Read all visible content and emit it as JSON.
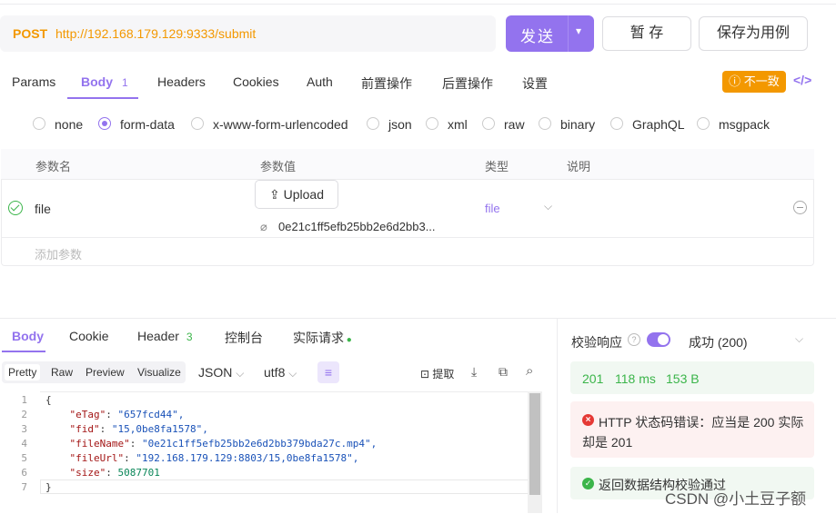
{
  "request": {
    "method": "POST",
    "url": "http://192.168.179.129:9333/submit",
    "send_label": "发送",
    "save_label": "暂 存",
    "save_case_label": "保存为用例"
  },
  "tabs": [
    {
      "label": "Params"
    },
    {
      "label": "Body",
      "badge": "1"
    },
    {
      "label": "Headers"
    },
    {
      "label": "Cookies"
    },
    {
      "label": "Auth"
    },
    {
      "label": "前置操作"
    },
    {
      "label": "后置操作"
    },
    {
      "label": "设置"
    }
  ],
  "inconsistent_label": "不一致",
  "body_types": [
    "none",
    "form-data",
    "x-www-form-urlencoded",
    "json",
    "xml",
    "raw",
    "binary",
    "GraphQL",
    "msgpack"
  ],
  "body_type_selected": "form-data",
  "params_table": {
    "headers": [
      "参数名",
      "参数值",
      "类型",
      "说明"
    ],
    "rows": [
      {
        "name": "file",
        "upload_label": "Upload",
        "file_name": "0e21c1ff5efb25bb2e6d2bb3...",
        "type": "file",
        "desc": ""
      }
    ],
    "add_placeholder": "添加参数"
  },
  "response_tabs": [
    {
      "label": "Body"
    },
    {
      "label": "Cookie"
    },
    {
      "label": "Header",
      "badge": "3"
    },
    {
      "label": "控制台"
    },
    {
      "label": "实际请求"
    }
  ],
  "view_modes": [
    "Pretty",
    "Raw",
    "Preview",
    "Visualize"
  ],
  "format": "JSON",
  "encoding": "utf8",
  "extract_label": "提取",
  "code_lines": [
    {
      "n": "1",
      "text": "{"
    },
    {
      "n": "2",
      "key": "\"eTag\"",
      "val": "\"657fcd44\","
    },
    {
      "n": "3",
      "key": "\"fid\"",
      "val": "\"15,0be8fa1578\","
    },
    {
      "n": "4",
      "key": "\"fileName\"",
      "val": "\"0e21c1ff5efb25bb2e6d2bb379bda27c.mp4\","
    },
    {
      "n": "5",
      "key": "\"fileUrl\"",
      "val": "\"192.168.179.129:8803/15,0be8fa1578\","
    },
    {
      "n": "6",
      "key": "\"size\"",
      "val": "5087701"
    },
    {
      "n": "7",
      "text": "}"
    }
  ],
  "validation": {
    "label": "校验响应",
    "result": "成功 (200)",
    "status": "201",
    "time": "118 ms",
    "size": "153 B",
    "error_text": "HTTP 状态码错误：应当是 200 实际却是 201",
    "ok_text": "返回数据结构校验通过"
  },
  "watermark": "CSDN @小土豆子额"
}
